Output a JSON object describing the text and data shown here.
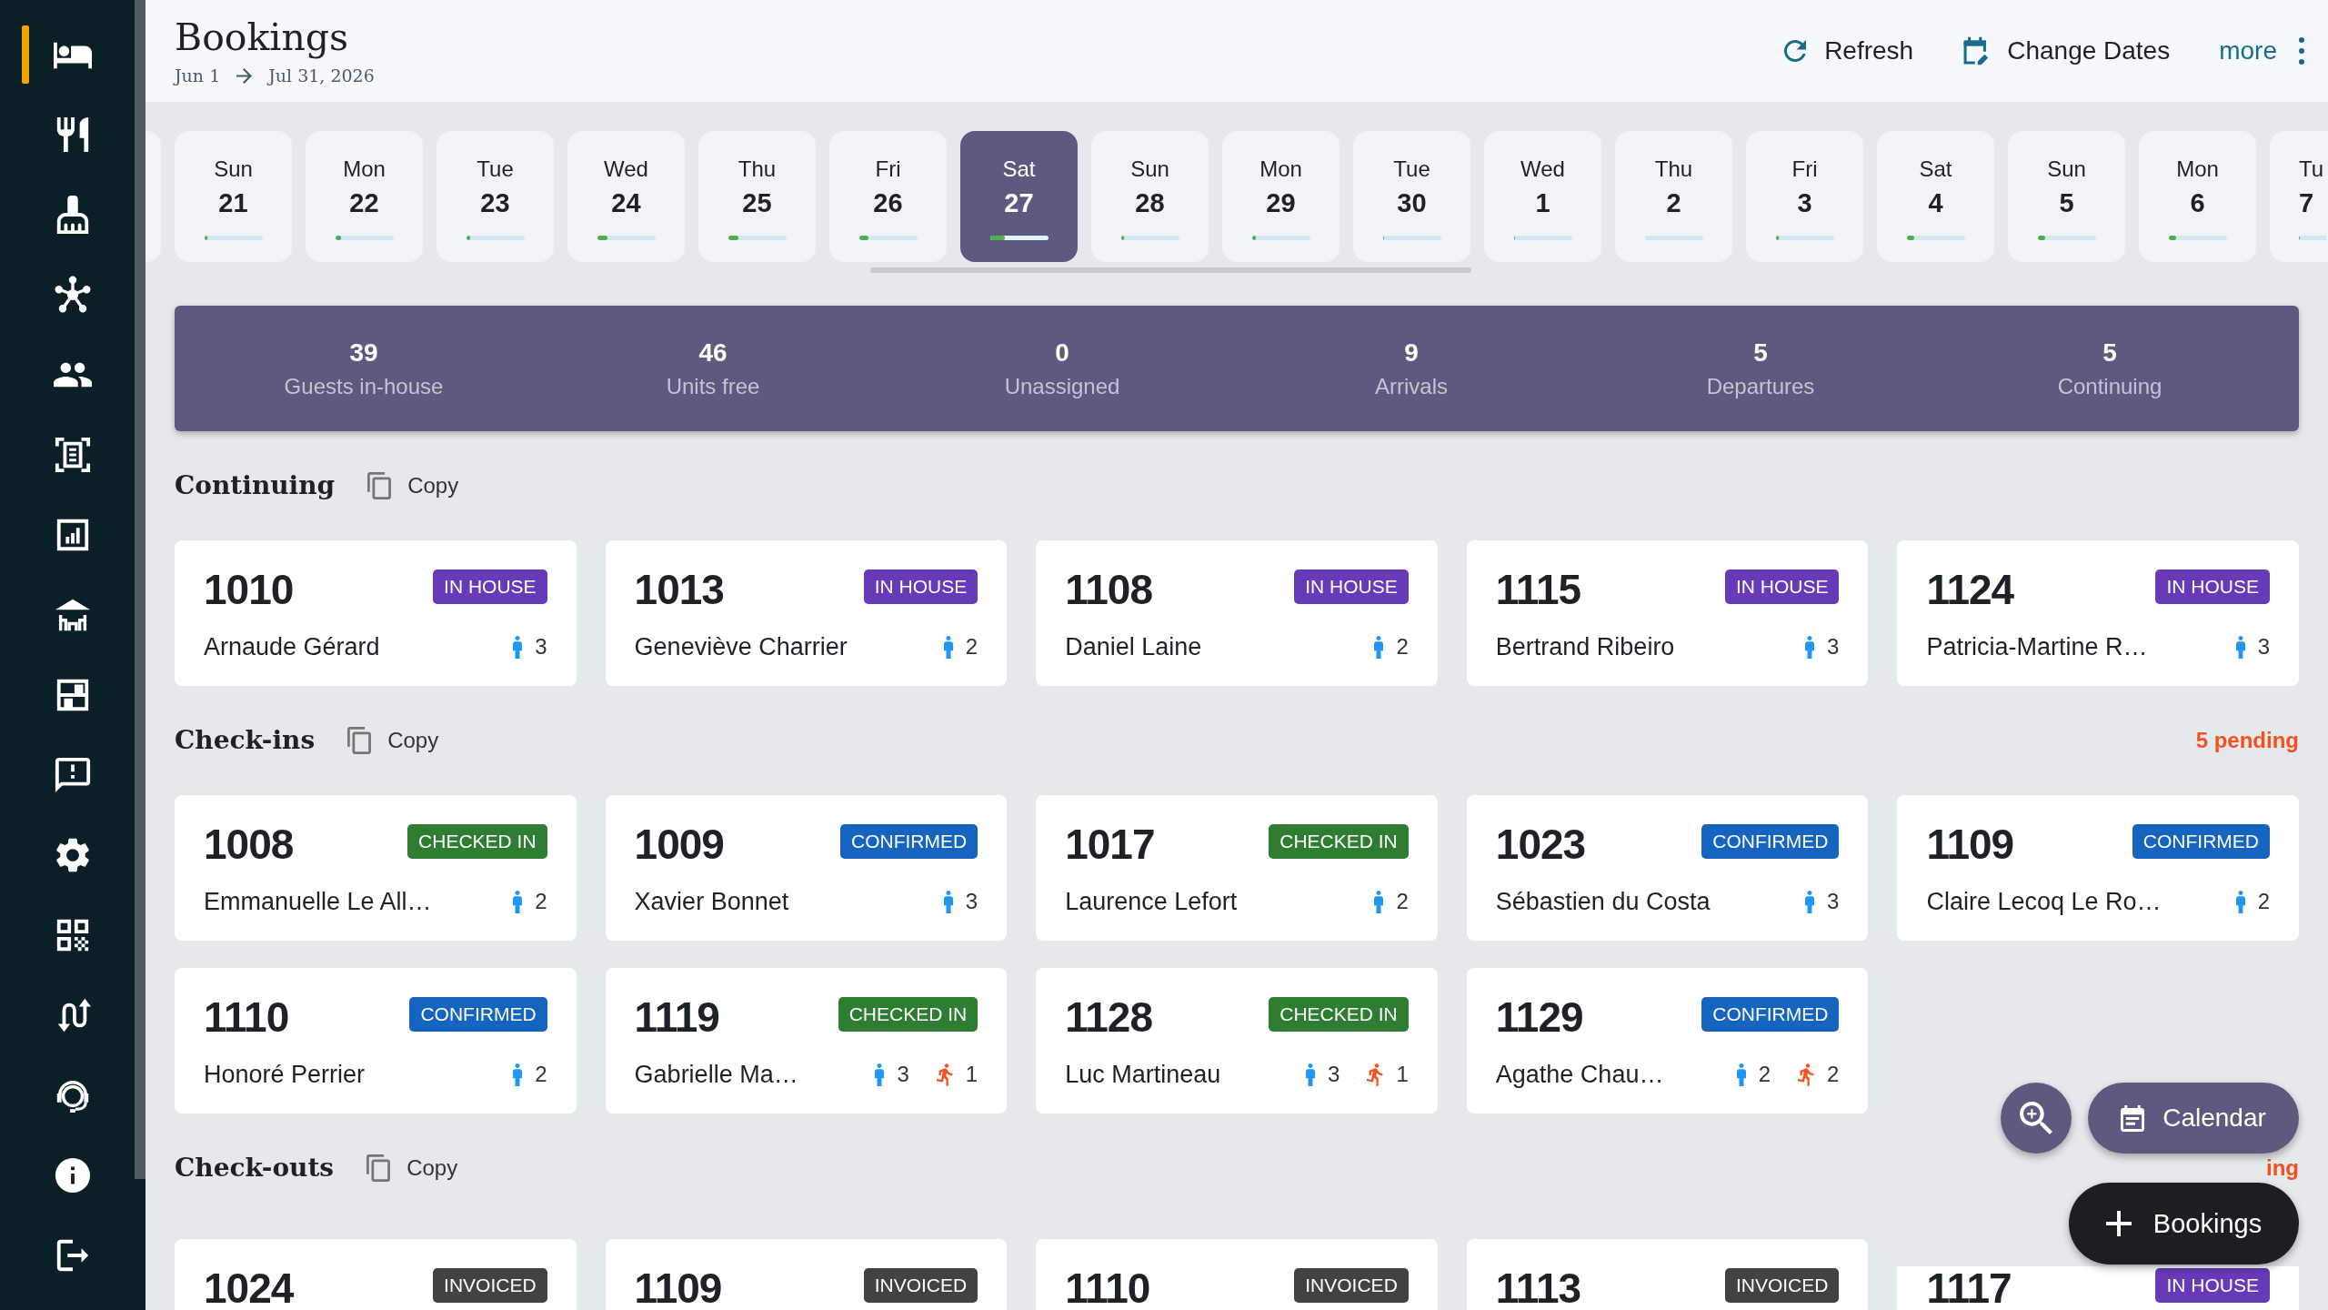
{
  "sidebar": {
    "items": [
      {
        "selected": true
      },
      {
        "selected": false
      },
      {
        "selected": false
      },
      {
        "selected": false
      },
      {
        "selected": false
      },
      {
        "selected": false
      },
      {
        "selected": false
      },
      {
        "selected": false
      },
      {
        "selected": false
      },
      {
        "selected": false
      },
      {
        "selected": false
      },
      {
        "selected": false
      },
      {
        "selected": false
      },
      {
        "selected": false
      },
      {
        "selected": false
      },
      {
        "selected": false
      }
    ]
  },
  "header": {
    "title": "Bookings",
    "range_start": "Jun 1",
    "range_end": "Jul 31, 2026",
    "actions": [
      {
        "label": "Refresh"
      },
      {
        "label": "Change Dates"
      }
    ],
    "more_label": "more"
  },
  "date_strip": {
    "days": [
      {
        "day": "Sun",
        "date": "21",
        "level": 0.05,
        "selected": false
      },
      {
        "day": "Mon",
        "date": "22",
        "level": 0.1,
        "selected": false
      },
      {
        "day": "Tue",
        "date": "23",
        "level": 0.07,
        "selected": false
      },
      {
        "day": "Wed",
        "date": "24",
        "level": 0.18,
        "selected": false
      },
      {
        "day": "Thu",
        "date": "25",
        "level": 0.18,
        "selected": false
      },
      {
        "day": "Fri",
        "date": "26",
        "level": 0.17,
        "selected": false
      },
      {
        "day": "Sat",
        "date": "27",
        "level": 0.25,
        "selected": true
      },
      {
        "day": "Sun",
        "date": "28",
        "level": 0.06,
        "selected": false
      },
      {
        "day": "Mon",
        "date": "29",
        "level": 0.07,
        "selected": false
      },
      {
        "day": "Tue",
        "date": "30",
        "level": 0.03,
        "selected": false
      },
      {
        "day": "Wed",
        "date": "1",
        "level": 0.03,
        "selected": false
      },
      {
        "day": "Thu",
        "date": "2",
        "level": 0,
        "selected": false
      },
      {
        "day": "Fri",
        "date": "3",
        "level": 0.05,
        "selected": false
      },
      {
        "day": "Sat",
        "date": "4",
        "level": 0.14,
        "selected": false
      },
      {
        "day": "Sun",
        "date": "5",
        "level": 0.14,
        "selected": false
      },
      {
        "day": "Mon",
        "date": "6",
        "level": 0.14,
        "selected": false
      },
      {
        "day": "Tu",
        "date": "7",
        "level": 0.04,
        "selected": false
      }
    ]
  },
  "stats": [
    {
      "value": "39",
      "label": "Guests in-house"
    },
    {
      "value": "46",
      "label": "Units free"
    },
    {
      "value": "0",
      "label": "Unassigned"
    },
    {
      "value": "9",
      "label": "Arrivals"
    },
    {
      "value": "5",
      "label": "Departures"
    },
    {
      "value": "5",
      "label": "Continuing"
    }
  ],
  "sections": [
    {
      "title": "Continuing",
      "copy_label": "Copy",
      "bookings": [
        {
          "unit": "1010",
          "status": "IN HOUSE",
          "color": "#673ab7",
          "guest": "Arnaude Gérard",
          "adults": "3"
        },
        {
          "unit": "1013",
          "status": "IN HOUSE",
          "color": "#673ab7",
          "guest": "Geneviève Charrier",
          "adults": "2"
        },
        {
          "unit": "1108",
          "status": "IN HOUSE",
          "color": "#673ab7",
          "guest": "Daniel Laine",
          "adults": "2"
        },
        {
          "unit": "1115",
          "status": "IN HOUSE",
          "color": "#673ab7",
          "guest": "Bertrand Ribeiro",
          "adults": "3"
        },
        {
          "unit": "1124",
          "status": "IN HOUSE",
          "color": "#673ab7",
          "guest": "Patricia-Martine R…",
          "adults": "3"
        }
      ]
    },
    {
      "title": "Check-ins",
      "copy_label": "Copy",
      "pending": "5 pending",
      "bookings": [
        {
          "unit": "1008",
          "status": "CHECKED IN",
          "color": "#2e7d32",
          "guest": "Emmanuelle Le All…",
          "adults": "2"
        },
        {
          "unit": "1009",
          "status": "CONFIRMED",
          "color": "#1565c0",
          "guest": "Xavier Bonnet",
          "adults": "3"
        },
        {
          "unit": "1017",
          "status": "CHECKED IN",
          "color": "#2e7d32",
          "guest": "Laurence Lefort",
          "adults": "2"
        },
        {
          "unit": "1023",
          "status": "CONFIRMED",
          "color": "#1565c0",
          "guest": "Sébastien du Costa",
          "adults": "3"
        },
        {
          "unit": "1109",
          "status": "CONFIRMED",
          "color": "#1565c0",
          "guest": "Claire Lecoq Le Ro…",
          "adults": "2"
        },
        {
          "unit": "1110",
          "status": "CONFIRMED",
          "color": "#1565c0",
          "guest": "Honoré Perrier",
          "adults": "2"
        },
        {
          "unit": "1119",
          "status": "CHECKED IN",
          "color": "#2e7d32",
          "guest": "Gabrielle Ma…",
          "adults": "3",
          "children": "1"
        },
        {
          "unit": "1128",
          "status": "CHECKED IN",
          "color": "#2e7d32",
          "guest": "Luc Martineau",
          "adults": "3",
          "children": "1"
        },
        {
          "unit": "1129",
          "status": "CONFIRMED",
          "color": "#1565c0",
          "guest": "Agathe Chau…",
          "adults": "2",
          "children": "2"
        }
      ]
    },
    {
      "title": "Check-outs",
      "copy_label": "Copy",
      "pending": "ing",
      "bookings": [
        {
          "unit": "1024",
          "status": "INVOICED",
          "color": "#424242"
        },
        {
          "unit": "1109",
          "status": "INVOICED",
          "color": "#424242"
        },
        {
          "unit": "1110",
          "status": "INVOICED",
          "color": "#424242"
        },
        {
          "unit": "1113",
          "status": "INVOICED",
          "color": "#424242"
        },
        {
          "unit": "1117",
          "status": "IN HOUSE",
          "color": "#673ab7"
        }
      ]
    }
  ],
  "fabs": {
    "calendar_label": "Calendar",
    "new_label": "Bookings"
  }
}
